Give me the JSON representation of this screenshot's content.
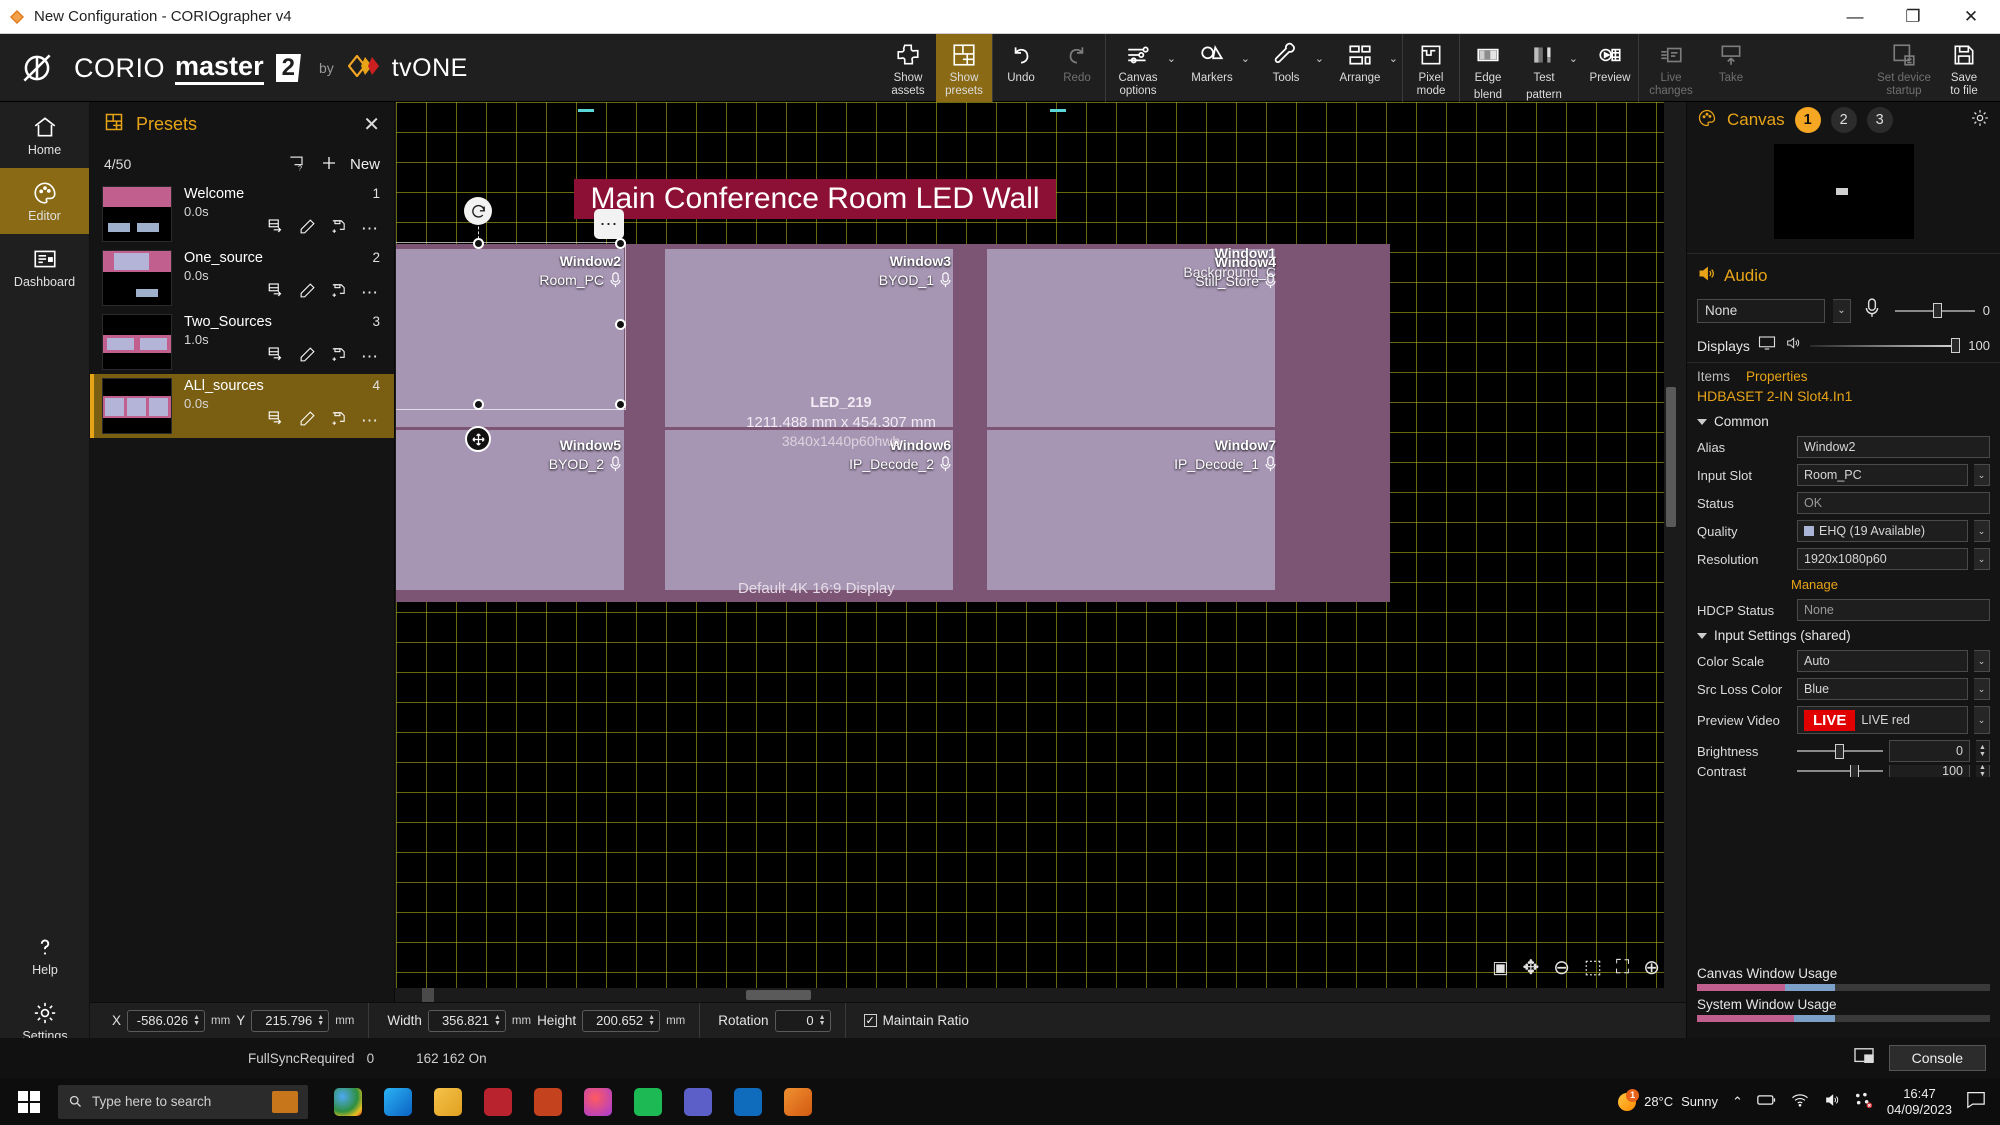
{
  "window": {
    "title": "New Configuration - CORIOgrapher v4",
    "minimize": "—",
    "maximize": "❐",
    "close": "✕"
  },
  "brand": {
    "corio": "CORIO",
    "master": "master",
    "two": "2",
    "by": "by",
    "tvone": "tvONE"
  },
  "ribbon": {
    "groups": [
      {
        "items": [
          {
            "name": "show-assets",
            "icon": "puzzle-icon",
            "l1": "Show",
            "l2": "assets",
            "selected": false,
            "disabled": false,
            "caret": false
          },
          {
            "name": "show-presets",
            "icon": "layout-grid-icon",
            "l1": "Show",
            "l2": "presets",
            "selected": true,
            "disabled": false,
            "caret": false
          }
        ]
      },
      {
        "items": [
          {
            "name": "undo",
            "icon": "undo-icon",
            "l1": "Undo",
            "l2": "",
            "selected": false,
            "disabled": false,
            "caret": false
          },
          {
            "name": "redo",
            "icon": "redo-icon",
            "l1": "Redo",
            "l2": "",
            "selected": false,
            "disabled": true,
            "caret": false
          }
        ]
      },
      {
        "items": [
          {
            "name": "canvas-options",
            "icon": "sliders-icon",
            "l1": "Canvas",
            "l2": "options",
            "selected": false,
            "disabled": false,
            "caret": true
          },
          {
            "name": "markers",
            "icon": "markers-icon",
            "l1": "Markers",
            "l2": "",
            "selected": false,
            "disabled": false,
            "caret": true
          },
          {
            "name": "tools",
            "icon": "wrench-icon",
            "l1": "Tools",
            "l2": "",
            "selected": false,
            "disabled": false,
            "caret": true
          },
          {
            "name": "arrange",
            "icon": "arrange-icon",
            "l1": "Arrange",
            "l2": "",
            "selected": false,
            "disabled": false,
            "caret": true
          }
        ]
      },
      {
        "items": [
          {
            "name": "pixel-mode",
            "icon": "pixel-icon",
            "l1": "Pixel",
            "l2": "mode",
            "selected": false,
            "disabled": false,
            "caret": false
          }
        ]
      },
      {
        "items": [
          {
            "name": "edge-blend",
            "icon": "edge-blend-icon",
            "l1": "Edge",
            "l2": "blend",
            "selected": false,
            "disabled": false,
            "caret": false
          },
          {
            "name": "test-pattern",
            "icon": "test-pattern-icon",
            "l1": "Test",
            "l2": "pattern",
            "selected": false,
            "disabled": false,
            "caret": true
          },
          {
            "name": "preview",
            "icon": "preview-icon",
            "l1": "Preview",
            "l2": "",
            "selected": false,
            "disabled": false,
            "caret": false
          }
        ]
      },
      {
        "items": [
          {
            "name": "live-changes",
            "icon": "live-icon",
            "l1": "Live",
            "l2": "changes",
            "selected": false,
            "disabled": true,
            "caret": false
          },
          {
            "name": "take",
            "icon": "take-icon",
            "l1": "Take",
            "l2": "",
            "selected": false,
            "disabled": true,
            "caret": false
          }
        ]
      }
    ],
    "right": [
      {
        "name": "set-device-startup",
        "icon": "device-startup-icon",
        "l1": "Set device",
        "l2": "startup",
        "disabled": true
      },
      {
        "name": "save-to-file",
        "icon": "save-icon",
        "l1": "Save",
        "l2": "to file",
        "disabled": false
      }
    ]
  },
  "rail": {
    "items": [
      {
        "name": "home",
        "icon": "home-icon",
        "label": "Home",
        "selected": false
      },
      {
        "name": "editor",
        "icon": "palette-icon",
        "label": "Editor",
        "selected": true
      },
      {
        "name": "dashboard",
        "icon": "dashboard-icon",
        "label": "Dashboard",
        "selected": false
      }
    ],
    "bottom": [
      {
        "name": "help",
        "icon": "question-icon",
        "label": "Help"
      },
      {
        "name": "settings",
        "icon": "gear-icon",
        "label": "Settings"
      }
    ]
  },
  "presets": {
    "title": "Presets",
    "count": "4/50",
    "new_label": "New",
    "close": "✕",
    "items": [
      {
        "name": "Welcome",
        "duration": "0.0s",
        "number": "1",
        "selected": false
      },
      {
        "name": "One_source",
        "duration": "0.0s",
        "number": "2",
        "selected": false
      },
      {
        "name": "Two_Sources",
        "duration": "1.0s",
        "number": "3",
        "selected": false
      },
      {
        "name": "ALl_sources",
        "duration": "0.0s",
        "number": "4",
        "selected": true
      }
    ]
  },
  "canvas": {
    "banner_text": "Main Conference Room LED Wall",
    "display_name": "Default 4K 16:9 Display",
    "led": {
      "name": "LED_219",
      "dimensions": "1211.488 mm x 454.307 mm",
      "resolution": "3840x1440p60hwb"
    },
    "windows": [
      {
        "name": "Window2",
        "source": "Room_PC"
      },
      {
        "name": "Window3",
        "source": "BYOD_1"
      },
      {
        "name": "Window1",
        "source": "Background_C"
      },
      {
        "name": "Window4",
        "source": "Still_Store"
      },
      {
        "name": "Window5",
        "source": "BYOD_2"
      },
      {
        "name": "Window6",
        "source": "IP_Decode_2"
      },
      {
        "name": "Window7",
        "source": "IP_Decode_1"
      }
    ],
    "zoom_controls": [
      {
        "name": "fit-to-window-icon",
        "glyph": "▣"
      },
      {
        "name": "pan-icon",
        "glyph": "✥"
      },
      {
        "name": "zoom-out-icon",
        "glyph": "⊖"
      },
      {
        "name": "fit-width-icon",
        "glyph": "⬚"
      },
      {
        "name": "fit-screen-icon",
        "glyph": "⛶"
      },
      {
        "name": "zoom-in-icon",
        "glyph": "⊕"
      }
    ]
  },
  "right_panel": {
    "canvas_title": "Canvas",
    "canvas_tabs": [
      "1",
      "2",
      "3"
    ],
    "canvas_active_tab": "1",
    "audio_title": "Audio",
    "audio_source": "None",
    "audio_level": "0",
    "displays_label": "Displays",
    "displays_level": "100",
    "tabs": {
      "items": [
        "Items",
        "Properties"
      ],
      "active": "Properties"
    },
    "device_title": "HDBASET 2-IN  Slot4.In1",
    "common_group": "Common",
    "common": [
      {
        "label": "Alias",
        "value": "Window2",
        "type": "text",
        "swatch": false
      },
      {
        "label": "Input Slot",
        "value": "Room_PC",
        "type": "dropdown",
        "swatch": false
      },
      {
        "label": "Status",
        "value": "OK",
        "type": "readonly",
        "swatch": false
      },
      {
        "label": "Quality",
        "value": "EHQ (19 Available)",
        "type": "dropdown",
        "swatch": true
      },
      {
        "label": "Resolution",
        "value": "1920x1080p60",
        "type": "dropdown",
        "swatch": false
      }
    ],
    "manage_link": "Manage",
    "hdcp": {
      "label": "HDCP Status",
      "value": "None"
    },
    "input_group": "Input Settings (shared)",
    "input_settings": [
      {
        "label": "Color Scale",
        "value": "Auto",
        "type": "dropdown"
      },
      {
        "label": "Src Loss Color",
        "value": "Blue",
        "type": "dropdown"
      }
    ],
    "preview_video": {
      "label": "Preview Video",
      "badge": "LIVE",
      "value": "LIVE red"
    },
    "brightness": {
      "label": "Brightness",
      "value": "0"
    },
    "contrast": {
      "label": "Contrast",
      "value": "100"
    },
    "usage": [
      {
        "label": "Canvas Window Usage",
        "pink_pct": 30,
        "blue_pct": 17
      },
      {
        "label": "System Window Usage",
        "pink_pct": 33,
        "blue_pct": 14
      }
    ]
  },
  "coordbar": {
    "x": {
      "label": "X",
      "value": "-586.026",
      "unit": "mm"
    },
    "y": {
      "label": "Y",
      "value": "215.796",
      "unit": "mm"
    },
    "width": {
      "label": "Width",
      "value": "356.821",
      "unit": "mm"
    },
    "height": {
      "label": "Height",
      "value": "200.652",
      "unit": "mm"
    },
    "rotation": {
      "label": "Rotation",
      "value": "0"
    },
    "maintain_ratio": {
      "label": "Maintain Ratio",
      "checked": true,
      "mark": "✓"
    }
  },
  "statusbar": {
    "sync": "FullSyncRequired",
    "sync_value": "0",
    "counters": "162  162  On",
    "console_label": "Console"
  },
  "taskbar": {
    "search_placeholder": "Type here to search",
    "weather_temp": "28°C",
    "weather_desc": "Sunny",
    "badge": "1",
    "time": "16:47",
    "date": "04/09/2023"
  },
  "colors": {
    "accent": "#e8a417",
    "selected_bg": "#8a6a14",
    "banner": "#8c1036",
    "window_fill": "#a99bb9",
    "display_fill": "#7d5574",
    "live_red": "#e00000"
  }
}
